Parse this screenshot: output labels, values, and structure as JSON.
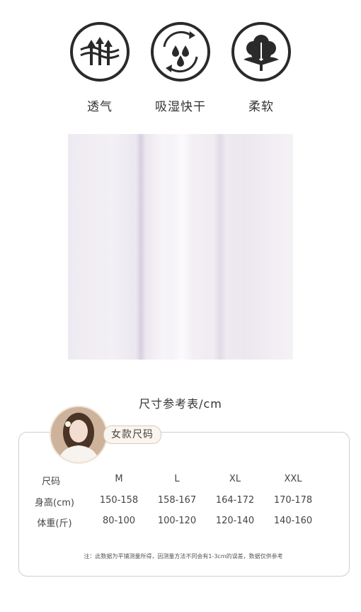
{
  "features": [
    {
      "icon": "breathable-arrows-icon",
      "label": "透气"
    },
    {
      "icon": "moisture-wicking-drops-icon",
      "label": "吸湿快干"
    },
    {
      "icon": "cotton-flower-icon",
      "label": "柔软"
    }
  ],
  "size_chart": {
    "title": "尺寸参考表/cm",
    "badge": "女款尺码",
    "headers": [
      "尺码",
      "M",
      "L",
      "XL",
      "XXL"
    ],
    "rows": [
      [
        "身高(cm)",
        "150-158",
        "158-167",
        "164-172",
        "170-178"
      ],
      [
        "体重(斤)",
        "80-100",
        "100-120",
        "120-140",
        "140-160"
      ]
    ],
    "note": "注：此数据为平铺测量所得，因测量方法不同会有1-3cm的误差，数据仅供参考"
  },
  "colors": {
    "icon_stroke": "#2a2a2a",
    "fabric": "#f0ecf3",
    "badge_bg": "#faf5ee"
  }
}
